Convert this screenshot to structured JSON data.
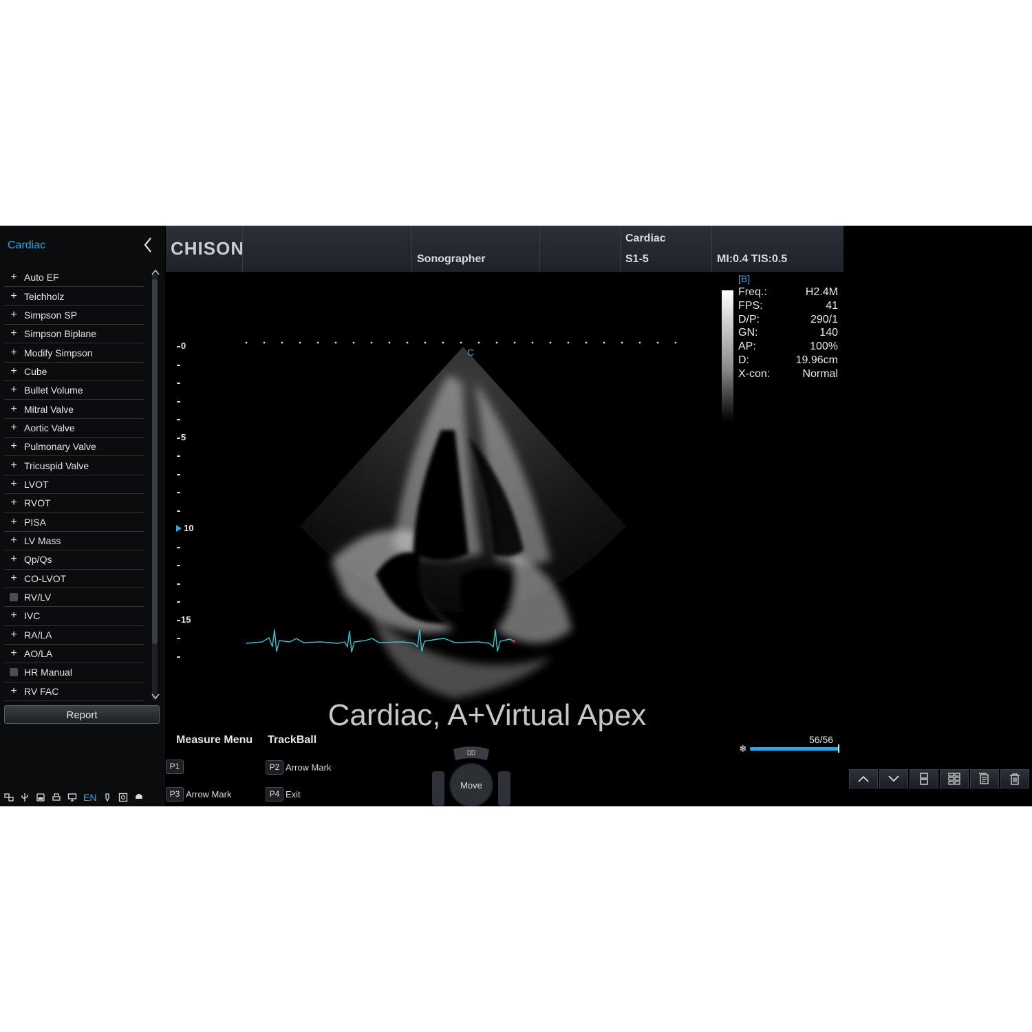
{
  "sidebar": {
    "title": "Cardiac",
    "items": [
      {
        "label": "Auto EF",
        "marker": "plus"
      },
      {
        "label": "Teichholz",
        "marker": "plus"
      },
      {
        "label": "Simpson SP",
        "marker": "plus"
      },
      {
        "label": "Simpson Biplane",
        "marker": "plus"
      },
      {
        "label": "Modify Simpson",
        "marker": "plus"
      },
      {
        "label": "Cube",
        "marker": "plus"
      },
      {
        "label": "Bullet Volume",
        "marker": "plus"
      },
      {
        "label": "Mitral Valve",
        "marker": "plus"
      },
      {
        "label": "Aortic Valve",
        "marker": "plus"
      },
      {
        "label": "Pulmonary Valve",
        "marker": "plus"
      },
      {
        "label": "Tricuspid Valve",
        "marker": "plus"
      },
      {
        "label": "LVOT",
        "marker": "plus"
      },
      {
        "label": "RVOT",
        "marker": "plus"
      },
      {
        "label": "PISA",
        "marker": "plus"
      },
      {
        "label": "LV Mass",
        "marker": "plus"
      },
      {
        "label": "Qp/Qs",
        "marker": "plus"
      },
      {
        "label": "CO-LVOT",
        "marker": "plus"
      },
      {
        "label": "RV/LV",
        "marker": "box"
      },
      {
        "label": "IVC",
        "marker": "plus"
      },
      {
        "label": "RA/LA",
        "marker": "plus"
      },
      {
        "label": "AO/LA",
        "marker": "plus"
      },
      {
        "label": "HR Manual",
        "marker": "box"
      },
      {
        "label": "RV FAC",
        "marker": "plus"
      }
    ],
    "report_label": "Report",
    "language": "EN",
    "status_icons": [
      "network-icon",
      "usb-icon",
      "storage-icon",
      "printer-icon",
      "monitor-icon",
      "probe-icon",
      "dvd-icon",
      "volume-icon"
    ]
  },
  "header": {
    "logo": "CHISON",
    "operator": "Sonographer",
    "exam": "Cardiac",
    "probe": "S1-5",
    "indices": "MI:0.4 TIS:0.5"
  },
  "image": {
    "mode": "[B]",
    "params": [
      {
        "label": "Freq.:",
        "value": "H2.4M"
      },
      {
        "label": "FPS:",
        "value": "41"
      },
      {
        "label": "D/P:",
        "value": "290/1"
      },
      {
        "label": "GN:",
        "value": "140"
      },
      {
        "label": "AP:",
        "value": "100%"
      },
      {
        "label": "D:",
        "value": "19.96cm"
      },
      {
        "label": "X-con:",
        "value": "Normal"
      }
    ],
    "depth_labels": [
      "0",
      "5",
      "10",
      "15"
    ],
    "focus_depth": "10",
    "centerline_marker": "C",
    "preset": "Cardiac, A+Virtual Apex",
    "ecg_color": "#35c6cf"
  },
  "controls": {
    "measure_menu": "Measure Menu",
    "trackball": "TrackBall",
    "p1": {
      "key": "P1",
      "label": ""
    },
    "p2": {
      "key": "P2",
      "label": "Arrow Mark"
    },
    "p3": {
      "key": "P3",
      "label": "Arrow Mark"
    },
    "p4": {
      "key": "P4",
      "label": "Exit"
    },
    "move": "Move",
    "cine_frame": "56/56",
    "cine_fraction": 1.0,
    "toolbar": [
      "chevron-up-icon",
      "chevron-down-icon",
      "layout-single-icon",
      "layout-grid-icon",
      "clipboard-icon",
      "trash-icon"
    ]
  },
  "colors": {
    "accent": "#2ea7e0",
    "background": "#000000",
    "header": "#252a31"
  }
}
